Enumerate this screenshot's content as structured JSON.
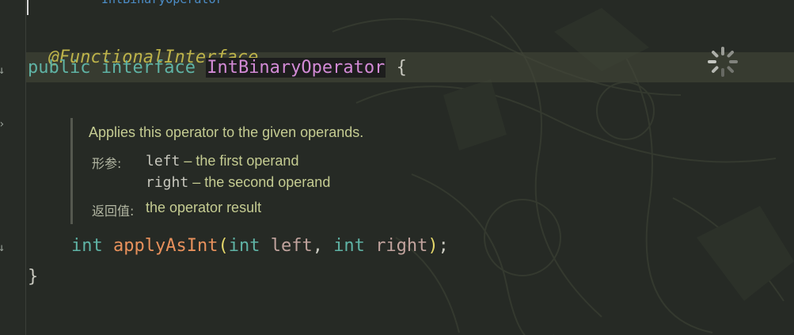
{
  "editor": {
    "truncated_top_text": "IntBinaryOperator",
    "annotation": "@FunctionalInterface",
    "decl": {
      "kw_public": "public",
      "kw_interface": "interface",
      "type_name": "IntBinaryOperator",
      "open_brace": "{"
    },
    "method": {
      "return_type": "int",
      "name": "applyAsInt",
      "open_paren": "(",
      "p1_type": "int",
      "p1_name": "left",
      "comma": ", ",
      "p2_type": "int",
      "p2_name": "right",
      "close_paren": ")",
      "semicolon": ";"
    },
    "close_brace": "}"
  },
  "doc": {
    "summary": "Applies this operator to the given operands.",
    "params_label": "形参:",
    "params": [
      {
        "name": "left",
        "desc": " – the first operand"
      },
      {
        "name": "right",
        "desc": " – the second operand"
      }
    ],
    "returns_label": "返回值:",
    "returns": "the operator result"
  },
  "icons": {
    "spinner": "loading-spinner-icon",
    "gutter_1": "implemented-arrow-icon",
    "gutter_2": "collapse-chevron-icon",
    "gutter_3": "implemented-arrow-icon"
  },
  "colors": {
    "keyword": "#5fb3a5",
    "annotation": "#bdb34a",
    "type_highlight": "#d38ad6",
    "method": "#e8915c",
    "background": "#262a25"
  }
}
